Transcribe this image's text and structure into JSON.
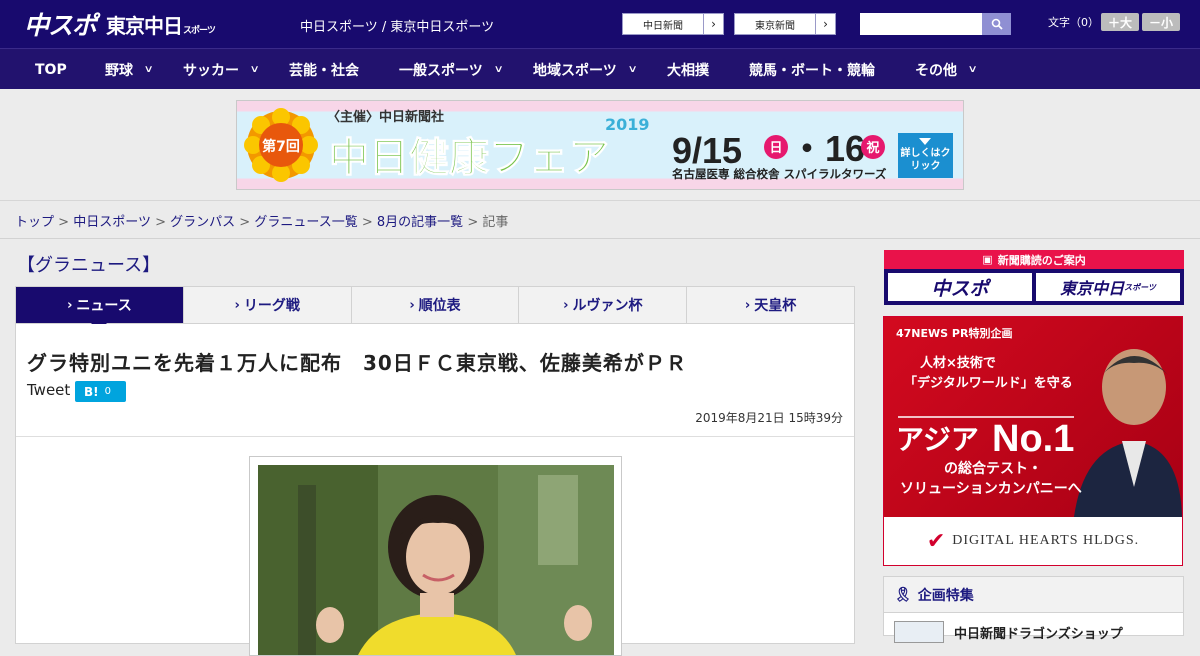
{
  "header": {
    "logo_main": "中スポ",
    "logo_sub": "東京中日",
    "logo_sub_small": "スポーツ",
    "site_tagline": "中日スポーツ / 東京中日スポーツ",
    "link_chunichi": "中日新聞",
    "link_tokyo": "東京新聞",
    "search_placeholder": "",
    "font_size_label": "文字（0）",
    "font_larger": "＋大",
    "font_smaller": "－小",
    "accent": "#180a6e"
  },
  "nav": {
    "items": [
      {
        "label": "TOP"
      },
      {
        "label": "野球"
      },
      {
        "label": "サッカー"
      },
      {
        "label": "芸能・社会"
      },
      {
        "label": "一般スポーツ"
      },
      {
        "label": "地域スポーツ"
      },
      {
        "label": "大相撲"
      },
      {
        "label": "競馬・ボート・競輪"
      },
      {
        "label": "その他"
      }
    ]
  },
  "banner": {
    "organizer": "〈主催〉中日新聞社",
    "badge": "第7回",
    "title": "中日健康フェア",
    "year": "2019",
    "date_main": "9/15",
    "day1": "日",
    "date_sep": "・16",
    "day2": "祝",
    "venue": "名古屋医専 総合校舎 スパイラルタワーズ",
    "cta": "詳しくはクリック"
  },
  "breadcrumb": {
    "items": [
      "トップ",
      "中日スポーツ",
      "グランパス",
      "グラニュース一覧",
      "8月の記事一覧"
    ],
    "current": "記事",
    "sep": ">"
  },
  "section": {
    "title": "【グラニュース】"
  },
  "tabs": [
    {
      "label": "ニュース",
      "active": true
    },
    {
      "label": "リーグ戦"
    },
    {
      "label": "順位表"
    },
    {
      "label": "ルヴァン杯"
    },
    {
      "label": "天皇杯"
    }
  ],
  "article": {
    "headline": "グラ特別ユニを先着１万人に配布　30日ＦＣ東京戦、佐藤美希がＰＲ",
    "tweet_label": "Tweet",
    "hatena_label": "B!",
    "hatena_count": "0",
    "date": "2019年8月21日 15時39分"
  },
  "sidebar": {
    "subscribe_header": "新聞購読のご案内",
    "subscribe_logo1": "中スポ",
    "subscribe_logo2": "東京中日",
    "subscribe_logo2_small": "スポーツ",
    "ad_tag": "47NEWS PR特別企画",
    "ad_line1": "人材×技術で",
    "ad_line2": "「デジタルワールド」を守る",
    "ad_line3": "アジア",
    "ad_line3b": "No.1",
    "ad_line4": "の総合テスト・",
    "ad_line5": "ソリューションカンパニーへ",
    "ad_company": "DIGITAL HEARTS HLDGS.",
    "feature_title": "企画特集",
    "feature_item": "中日新聞ドラゴンズショップ"
  }
}
